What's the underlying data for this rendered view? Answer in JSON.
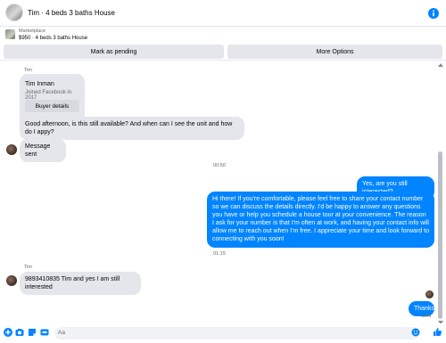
{
  "header": {
    "title": "Tim · 4 beds 3 baths House"
  },
  "marketplace": {
    "label": "Marketplace",
    "listing": "$950 · 4 beds 3 baths House"
  },
  "actions": {
    "pending": "Mark as pending",
    "more": "More Options"
  },
  "profile": {
    "sender": "Tim",
    "name": "Tim Inman",
    "joined": "Joined Facebook in 2017",
    "details_button": "Buyer details"
  },
  "messages": {
    "m1": "Good afternoon, is this still available? And when can I see the unit and how do I appy?",
    "m2": "Message sent",
    "t1": "00:50",
    "o1": "Yes, are you still interested?",
    "o2": "Hi there! If you're comfortable, please feel free to share your contact number so we can discuss the details directly. I'd be happy to answer any questions you have or help you schedule a house tour at your convenience. The reason I ask for your number is that I'm often at work, and having your contact info will allow me to reach out when I'm free. I appreciate your time and look forward to connecting with you soon!",
    "t2": "01:15",
    "sender2": "Tim",
    "m3": "9893410835 Tim and yes I am still interested",
    "o3": "Thanks",
    "seen": "Sent"
  },
  "composer": {
    "placeholder": "Aa"
  },
  "colors": {
    "accent": "#0084ff",
    "bubble_in": "#e4e6eb"
  },
  "icons": [
    "info-icon",
    "plus-icon",
    "camera-icon",
    "sticker-icon",
    "gif-icon",
    "emoji-icon",
    "like-icon"
  ]
}
